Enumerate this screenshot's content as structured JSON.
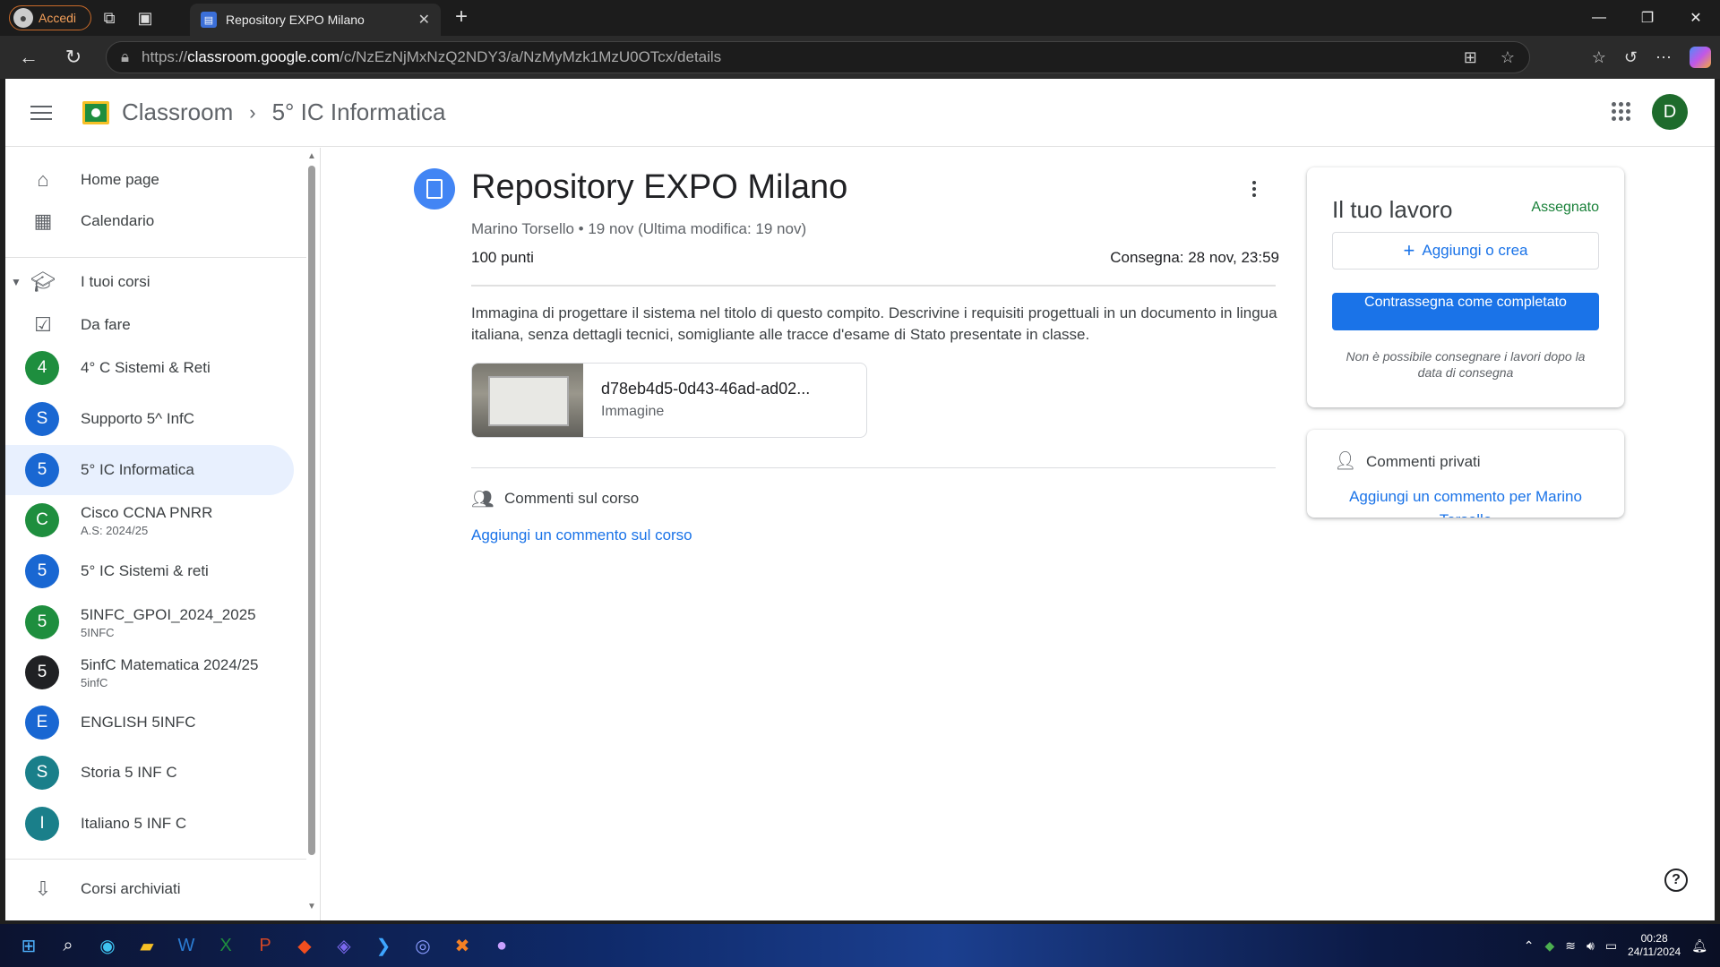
{
  "browser": {
    "profile_label": "Accedi",
    "tab_title": "Repository EXPO Milano",
    "url_prefix": "https://",
    "url_host": "classroom.google.com",
    "url_path": "/c/NzEzNjMxNzQ2NDY3/a/NzMyMzk1MzU0OTcx/details"
  },
  "header": {
    "brand": "Classroom",
    "breadcrumb": "5° IC Informatica",
    "avatar_letter": "D"
  },
  "sidebar": {
    "home": "Home page",
    "calendar": "Calendario",
    "your_courses": "I tuoi corsi",
    "todo": "Da fare",
    "courses": [
      {
        "letter": "4",
        "name": "4° C Sistemi & Reti",
        "sub": "",
        "color": "#1e8e3e"
      },
      {
        "letter": "S",
        "name": "Supporto 5^ InfC",
        "sub": "",
        "color": "#1967d2"
      },
      {
        "letter": "5",
        "name": "5° IC Informatica",
        "sub": "",
        "color": "#1967d2"
      },
      {
        "letter": "C",
        "name": "Cisco CCNA PNRR",
        "sub": "A.S: 2024/25",
        "color": "#1e8e3e"
      },
      {
        "letter": "5",
        "name": "5° IC Sistemi & reti",
        "sub": "",
        "color": "#1967d2"
      },
      {
        "letter": "5",
        "name": "5INFC_GPOI_2024_2025",
        "sub": "5INFC",
        "color": "#1e8e3e"
      },
      {
        "letter": "5",
        "name": "5infC Matematica 2024/25",
        "sub": "5infC",
        "color": "#202124"
      },
      {
        "letter": "E",
        "name": "ENGLISH 5INFC",
        "sub": "",
        "color": "#1967d2"
      },
      {
        "letter": "S",
        "name": "Storia 5 INF C",
        "sub": "",
        "color": "#1a7f8a"
      },
      {
        "letter": "I",
        "name": "Italiano 5 INF C",
        "sub": "",
        "color": "#1a7f8a"
      }
    ],
    "archived": "Corsi archiviati"
  },
  "assignment": {
    "title": "Repository EXPO Milano",
    "meta": "Marino Torsello • 19 nov (Ultima modifica: 19 nov)",
    "points": "100 punti",
    "due": "Consegna: 28 nov, 23:59",
    "description": "Immagina di progettare il sistema nel titolo di questo compito. Descrivine i requisiti progettuali in un documento in lingua italiana, senza dettagli tecnici, somigliante alle tracce  d'esame di Stato presentate in classe.",
    "attachment_name": "d78eb4d5-0d43-46ad-ad02...",
    "attachment_type": "Immagine",
    "class_comments_title": "Commenti sul corso",
    "class_comments_link": "Aggiungi un commento sul corso"
  },
  "your_work": {
    "title": "Il tuo lavoro",
    "status": "Assegnato",
    "add_label": "Aggiungi o crea",
    "mark_label": "Contrassegna come completato",
    "note": "Non è possibile consegnare i lavori dopo la data di consegna"
  },
  "private_comments": {
    "title": "Commenti privati",
    "link": "Aggiungi un commento per Marino Torsello"
  },
  "taskbar": {
    "time": "00:28",
    "date": "24/11/2024"
  }
}
